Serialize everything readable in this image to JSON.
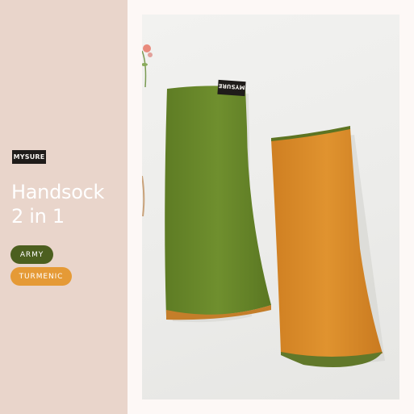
{
  "brand": {
    "logo_text": "MYSURE"
  },
  "headline": {
    "line1": "Handsock",
    "line2": "2 in 1"
  },
  "colors_options": [
    {
      "label": "ARMY",
      "color": "#4c5f1f"
    },
    {
      "label": "TURMENIC",
      "color": "#e59a36"
    }
  ],
  "product_photo": {
    "tag_text": "MYSURE",
    "army_color": "#6b8a2b",
    "turmenic_color": "#d98a2c"
  },
  "palette": {
    "left_panel": "#e9d5cb",
    "background": "#fdf8f6"
  }
}
